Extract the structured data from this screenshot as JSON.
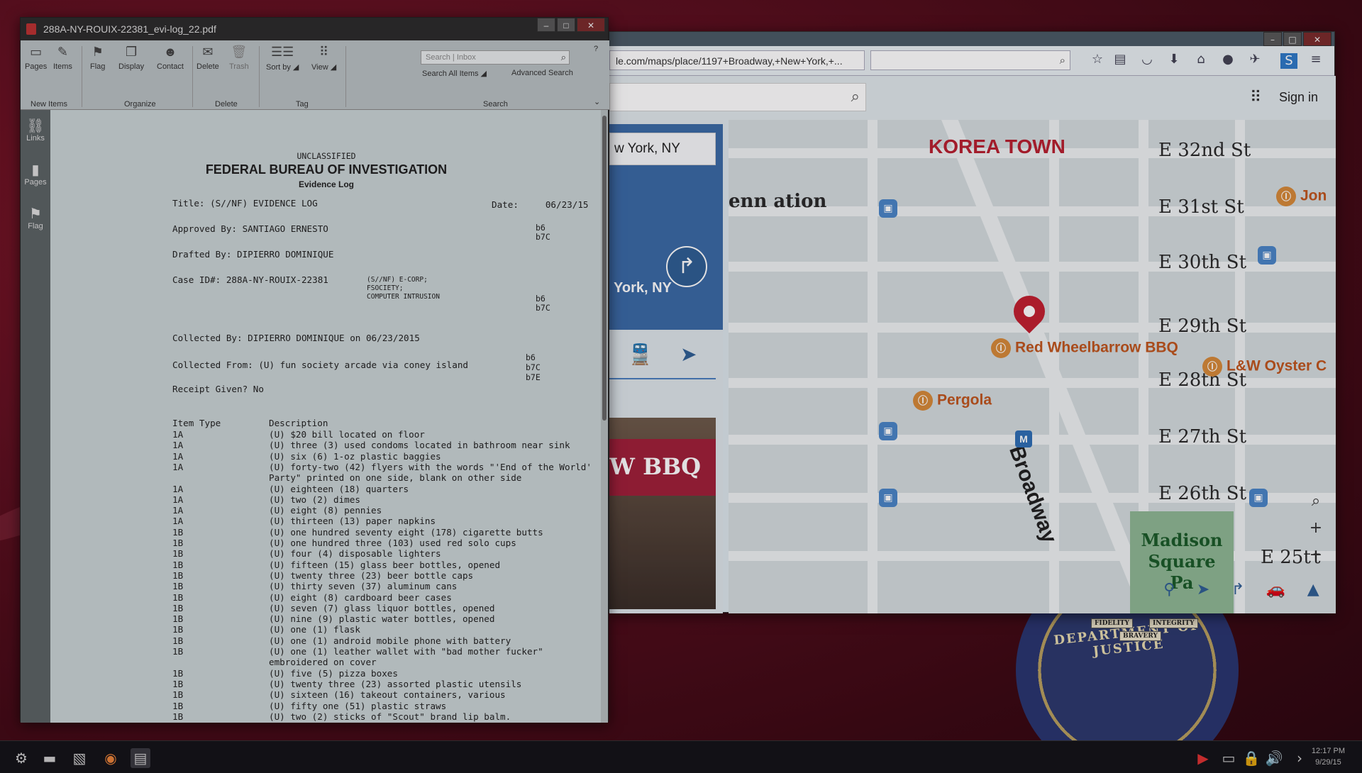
{
  "pdf_window": {
    "title": "288A-NY-ROUIX-22381_evi-log_22.pdf",
    "ribbon": {
      "buttons": {
        "pages": "Pages",
        "items": "Items",
        "flag": "Flag",
        "display": "Display",
        "contact": "Contact",
        "delete": "Delete",
        "trash": "Trash",
        "sort_by": "Sort by",
        "view": "View"
      },
      "groups": {
        "new_items": "New Items",
        "organize": "Organize",
        "delete": "Delete",
        "tag": "Tag",
        "search": "Search"
      },
      "search_placeholder": "Search | Inbox",
      "search_all_items": "Search All Items",
      "advanced_search": "Advanced Search"
    },
    "sidebar": [
      "Links",
      "Pages",
      "Flag"
    ],
    "document": {
      "classification": "UNCLASSIFIED",
      "agency": "FEDERAL BUREAU OF INVESTIGATION",
      "subtitle": "Evidence Log",
      "title_line": "Title: (S//NF) EVIDENCE LOG",
      "date_line": "Date:     06/23/15",
      "approved_by": "Approved By: SANTIAGO ERNESTO",
      "redact1": "b6\nb7C",
      "drafted_by": "Drafted By: DIPIERRO DOMINIQUE",
      "case_id": "Case ID#: 288A-NY-ROUIX-22381",
      "case_desc": "(S//NF) E-CORP;\nFSOCIETY;\nCOMPUTER INTRUSION",
      "redact2": "b6\nb7C",
      "collected_by": "Collected By: DIPIERRO DOMINIQUE on 06/23/2015",
      "collected_from": "Collected From: (U) fun society arcade via coney island",
      "redact3": "b6\nb7C\nb7E",
      "receipt": "Receipt Given? No",
      "col_item": "Item Type",
      "col_desc": "Description",
      "items": [
        {
          "type": "1A",
          "desc": "(U) $20 bill located on floor"
        },
        {
          "type": "1A",
          "desc": "(U) three (3) used condoms located in bathroom near sink"
        },
        {
          "type": "1A",
          "desc": "(U) six (6) 1-oz plastic baggies"
        },
        {
          "type": "1A",
          "desc": "(U) forty-two (42) flyers with the words \"'End of the World'\nParty\" printed on one side, blank on other side"
        },
        {
          "type": "1A",
          "desc": "(U) eighteen (18) quarters"
        },
        {
          "type": "1A",
          "desc": "(U) two (2) dimes"
        },
        {
          "type": "1A",
          "desc": "(U) eight (8) pennies"
        },
        {
          "type": "1A",
          "desc": "(U) thirteen (13) paper napkins"
        },
        {
          "type": "1B",
          "desc": "(U) one hundred seventy eight (178) cigarette butts"
        },
        {
          "type": "1B",
          "desc": "(U) one hundred three (103) used red solo cups"
        },
        {
          "type": "1B",
          "desc": "(U) four (4) disposable lighters"
        },
        {
          "type": "1B",
          "desc": "(U) fifteen (15) glass beer bottles, opened"
        },
        {
          "type": "1B",
          "desc": "(U) twenty three (23) beer bottle caps"
        },
        {
          "type": "1B",
          "desc": "(U) thirty seven (37) aluminum cans"
        },
        {
          "type": "1B",
          "desc": "(U) eight (8) cardboard beer cases"
        },
        {
          "type": "1B",
          "desc": "(U) seven (7) glass liquor bottles, opened"
        },
        {
          "type": "1B",
          "desc": "(U) nine (9) plastic water bottles, opened"
        },
        {
          "type": "1B",
          "desc": "(U) one (1) flask"
        },
        {
          "type": "1B",
          "desc": "(U) one (1) android mobile phone with battery"
        },
        {
          "type": "1B",
          "desc": "(U) one (1) leather wallet with \"bad mother fucker\"\nembroidered on cover"
        },
        {
          "type": "1B",
          "desc": "(U) five (5) pizza boxes"
        },
        {
          "type": "1B",
          "desc": "(U) twenty three (23) assorted plastic utensils"
        },
        {
          "type": "1B",
          "desc": "(U) sixteen (16) takeout containers, various"
        },
        {
          "type": "1B",
          "desc": "(U) fifty one (51) plastic straws"
        },
        {
          "type": "1B",
          "desc": "(U) two (2) sticks of \"Scout\" brand lip balm."
        }
      ]
    }
  },
  "browser": {
    "url": "le.com/maps/place/1197+Broadway,+New+York,+...",
    "sign_in": "Sign in",
    "place_box": "w York, NY",
    "place_name": "York, NY",
    "photo_sign": "W BBQ",
    "map": {
      "neighborhood": "KOREA TOWN",
      "partial_label": "enn\nation",
      "streets": [
        "E 32nd St",
        "E 31st St",
        "E 30th St",
        "E 29th St",
        "E 28th St",
        "E 27th St",
        "E 26th St",
        "E 25t",
        "t"
      ],
      "avenue": "Broadway",
      "pois": [
        "Red Wheelbarrow BBQ",
        "L&W Oyster C",
        "Pergola",
        "Jon"
      ],
      "park": "Madison\nSquare\nPa",
      "metro_label": "M"
    }
  },
  "seal": {
    "text": "DEPARTMENT OF JUSTICE",
    "mottos": [
      "FIDELITY",
      "BRAVERY",
      "INTEGRITY"
    ]
  },
  "taskbar": {
    "time": "12:17 PM",
    "date": "9/29/15"
  }
}
